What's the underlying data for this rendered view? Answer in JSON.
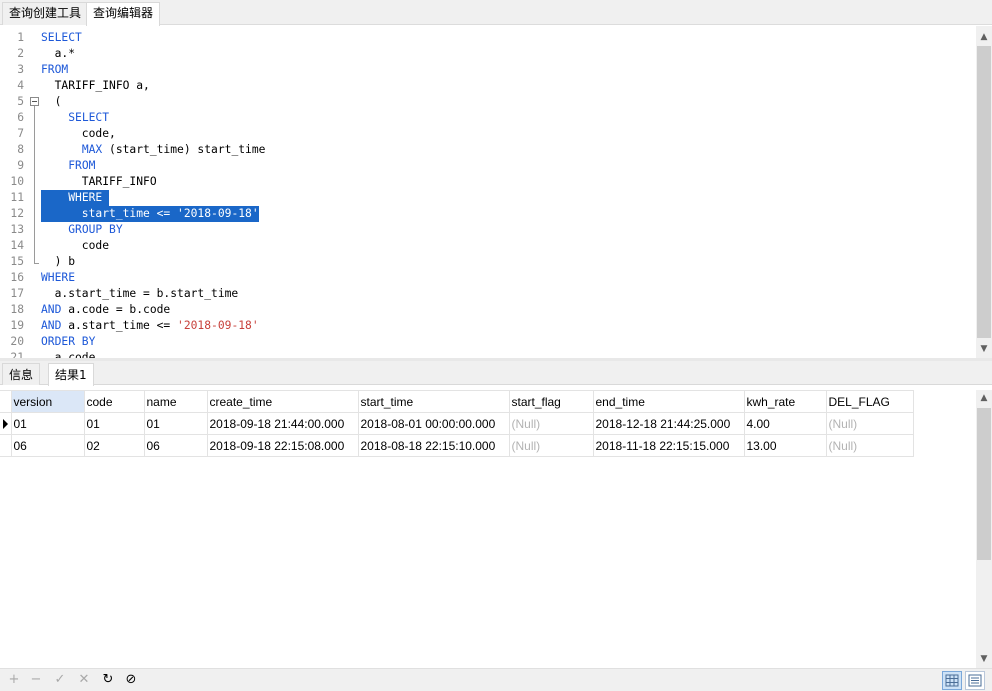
{
  "top_tabs": [
    {
      "label": "查询创建工具",
      "active": false
    },
    {
      "label": "查询编辑器",
      "active": true
    }
  ],
  "editor": {
    "lines": [
      {
        "n": "1",
        "parts": [
          [
            "kw",
            "SELECT"
          ]
        ]
      },
      {
        "n": "2",
        "parts": [
          [
            "t",
            "  a.*"
          ]
        ]
      },
      {
        "n": "3",
        "parts": [
          [
            "kw",
            "FROM"
          ]
        ]
      },
      {
        "n": "4",
        "parts": [
          [
            "t",
            "  TARIFF_INFO a,"
          ]
        ]
      },
      {
        "n": "5",
        "parts": [
          [
            "t",
            "  ("
          ]
        ]
      },
      {
        "n": "6",
        "parts": [
          [
            "t",
            "    "
          ],
          [
            "kw",
            "SELECT"
          ]
        ]
      },
      {
        "n": "7",
        "parts": [
          [
            "t",
            "      code,"
          ]
        ]
      },
      {
        "n": "8",
        "parts": [
          [
            "t",
            "      "
          ],
          [
            "kw",
            "MAX"
          ],
          [
            "t",
            " (start_time) start_time"
          ]
        ]
      },
      {
        "n": "9",
        "parts": [
          [
            "t",
            "    "
          ],
          [
            "kw",
            "FROM"
          ]
        ]
      },
      {
        "n": "10",
        "parts": [
          [
            "t",
            "      TARIFF_INFO"
          ]
        ]
      },
      {
        "n": "11",
        "parts": [
          [
            "t",
            "    "
          ],
          [
            "kw",
            "WHERE"
          ],
          [
            "t",
            " "
          ]
        ],
        "selected": true
      },
      {
        "n": "12",
        "parts": [
          [
            "t",
            "      start_time <= "
          ],
          [
            "str",
            "'2018-09-18'"
          ]
        ],
        "selected": true
      },
      {
        "n": "13",
        "parts": [
          [
            "t",
            "    "
          ],
          [
            "kw",
            "GROUP BY"
          ]
        ]
      },
      {
        "n": "14",
        "parts": [
          [
            "t",
            "      code"
          ]
        ]
      },
      {
        "n": "15",
        "parts": [
          [
            "t",
            "  ) b"
          ]
        ]
      },
      {
        "n": "16",
        "parts": [
          [
            "kw",
            "WHERE"
          ]
        ]
      },
      {
        "n": "17",
        "parts": [
          [
            "t",
            "  a.start_time = b.start_time"
          ]
        ]
      },
      {
        "n": "18",
        "parts": [
          [
            "kw",
            "AND"
          ],
          [
            "t",
            " a.code = b.code"
          ]
        ]
      },
      {
        "n": "19",
        "parts": [
          [
            "kw",
            "AND"
          ],
          [
            "t",
            " a.start_time <= "
          ],
          [
            "str",
            "'2018-09-18'"
          ]
        ]
      },
      {
        "n": "20",
        "parts": [
          [
            "kw",
            "ORDER BY"
          ]
        ]
      },
      {
        "n": "21",
        "parts": [
          [
            "t",
            "  a.code"
          ]
        ]
      }
    ]
  },
  "bottom_tabs": [
    {
      "label": "信息",
      "active": false
    },
    {
      "label": "结果1",
      "active": true
    }
  ],
  "result_grid": {
    "columns": [
      {
        "label": "version",
        "width": 73
      },
      {
        "label": "code",
        "width": 60
      },
      {
        "label": "name",
        "width": 63
      },
      {
        "label": "create_time",
        "width": 151
      },
      {
        "label": "start_time",
        "width": 151
      },
      {
        "label": "start_flag",
        "width": 84
      },
      {
        "label": "end_time",
        "width": 151
      },
      {
        "label": "kwh_rate",
        "width": 82
      },
      {
        "label": "DEL_FLAG",
        "width": 87
      }
    ],
    "rows": [
      [
        "01",
        "01",
        "01",
        "2018-09-18 21:44:00.000",
        "2018-08-01 00:00:00.000",
        "(Null)",
        "2018-12-18 21:44:25.000",
        "4.00",
        "(Null)"
      ],
      [
        "06",
        "02",
        "06",
        "2018-09-18 22:15:08.000",
        "2018-08-18 22:15:10.000",
        "(Null)",
        "2018-11-18 22:15:15.000",
        "13.00",
        "(Null)"
      ]
    ],
    "current_row": 0
  },
  "toolbar": {
    "buttons": [
      {
        "name": "add-record-button",
        "glyph": "+",
        "enabled": false
      },
      {
        "name": "delete-record-button",
        "glyph": "−",
        "enabled": false
      },
      {
        "name": "apply-changes-button",
        "glyph": "✓",
        "enabled": false
      },
      {
        "name": "discard-changes-button",
        "glyph": "✕",
        "enabled": false
      },
      {
        "name": "refresh-button",
        "glyph": "↻",
        "enabled": true
      },
      {
        "name": "stop-button",
        "glyph": "⊘",
        "enabled": true
      }
    ],
    "view_modes": [
      {
        "name": "grid-view-button",
        "active": true
      },
      {
        "name": "form-view-button",
        "active": false
      }
    ]
  },
  "colors": {
    "keyword": "#1d58d8",
    "string": "#c8413b",
    "selection": "#1a67c8",
    "null_text": "#b3b3b3",
    "header_highlight": "#dbe7f7"
  }
}
